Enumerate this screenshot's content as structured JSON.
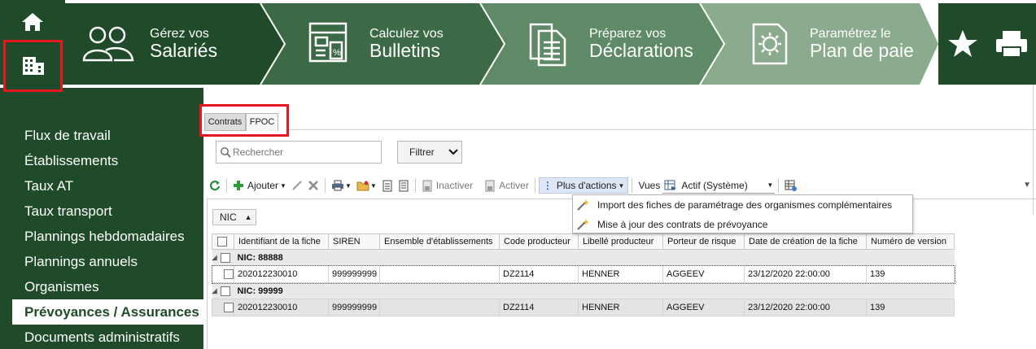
{
  "colors": {
    "dark_green": "#1f4b2a",
    "highlight_red": "#e8161e",
    "step1": "#1f4b2a",
    "step2": "#3c6a47",
    "step3": "#5f8a67",
    "step4": "#8aab8e"
  },
  "header": {
    "steps": [
      {
        "small": "Gérez vos",
        "big": "Salariés",
        "icon": "people-icon"
      },
      {
        "small": "Calculez vos",
        "big": "Bulletins",
        "icon": "calculator-icon"
      },
      {
        "small": "Préparez vos",
        "big": "Déclarations",
        "icon": "document-icon"
      },
      {
        "small": "Paramétrez le",
        "big": "Plan de paie",
        "icon": "gear-doc-icon"
      }
    ]
  },
  "sidebar": {
    "items": [
      {
        "label": "Flux de travail"
      },
      {
        "label": "Établissements"
      },
      {
        "label": "Taux AT"
      },
      {
        "label": "Taux transport"
      },
      {
        "label": "Plannings hebdomadaires"
      },
      {
        "label": "Plannings annuels"
      },
      {
        "label": "Organismes"
      },
      {
        "label": "Prévoyances / Assurances",
        "active": true
      },
      {
        "label": "Documents administratifs"
      }
    ]
  },
  "tabs": {
    "contrats": "Contrats",
    "fpoc": "FPOC"
  },
  "search": {
    "placeholder": "Rechercher"
  },
  "filter": {
    "label": "Filtrer"
  },
  "toolbar": {
    "ajouter": "Ajouter",
    "inactiver": "Inactiver",
    "activer": "Activer",
    "plus_actions": "Plus d'actions",
    "vues": "Vues",
    "vue_selected": "Actif (Système)"
  },
  "dropdown": {
    "items": [
      "Import des fiches de paramétrage des organismes complémentaires",
      "Mise à jour des contrats de prévoyance"
    ]
  },
  "grid": {
    "group_by": "NIC",
    "columns": [
      "Identifiant de la fiche",
      "SIREN",
      "Ensemble d'établissements",
      "Code producteur",
      "Libellé producteur",
      "Porteur de risque",
      "Date de création de la fiche",
      "Numéro de version"
    ],
    "groups": [
      {
        "label": "NIC: 88888",
        "row": [
          "202012230010",
          "999999999",
          "",
          "DZ2114",
          "HENNER",
          "AGGEEV",
          "23/12/2020 22:00:00",
          "139"
        ]
      },
      {
        "label": "NIC: 99999",
        "row": [
          "202012230010",
          "999999999",
          "",
          "DZ2114",
          "HENNER",
          "AGGEEV",
          "23/12/2020 22:00:00",
          "139"
        ]
      }
    ]
  }
}
